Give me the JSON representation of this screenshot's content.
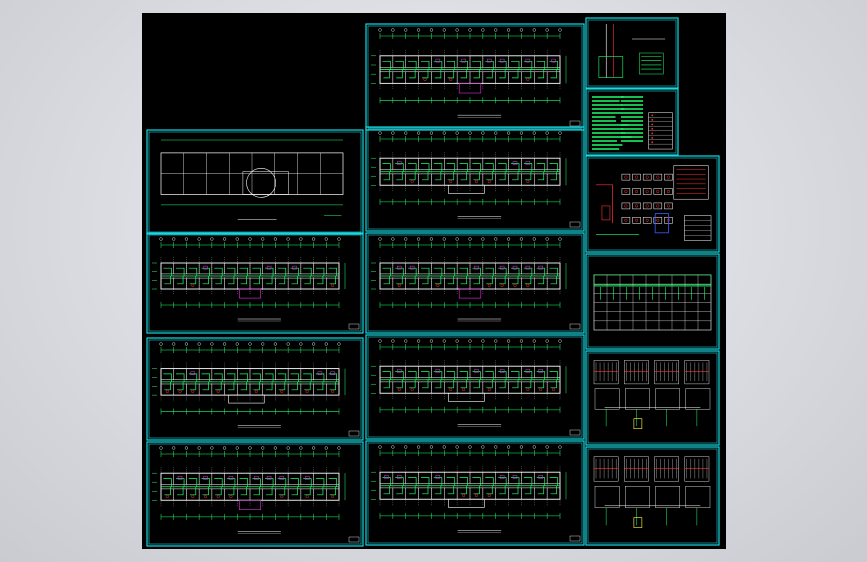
{
  "viewport": {
    "title": ""
  },
  "colors": {
    "background": "#d9dbe0",
    "canvas": "#000000",
    "frame": "#18d8e0",
    "wall": "#ffffff",
    "wiring": "#1cff6a",
    "magenta": "#e030e0",
    "red": "#ff3030",
    "yellow": "#ffff40",
    "blue": "#3060ff"
  },
  "sheets": [
    {
      "id": "floor-plan-top",
      "kind": "floor-plan",
      "label": ""
    },
    {
      "id": "site-plan",
      "kind": "site-plan",
      "label": ""
    },
    {
      "id": "floor-plan-c2",
      "kind": "floor-plan",
      "label": ""
    },
    {
      "id": "floor-plan-c3",
      "kind": "floor-plan",
      "label": ""
    },
    {
      "id": "floor-plan-c4",
      "kind": "floor-plan",
      "label": ""
    },
    {
      "id": "floor-plan-left-1",
      "kind": "floor-plan",
      "label": ""
    },
    {
      "id": "floor-plan-left-2",
      "kind": "floor-plan",
      "label": ""
    },
    {
      "id": "floor-plan-left-3",
      "kind": "floor-plan",
      "label": ""
    },
    {
      "id": "floor-plan-c5",
      "kind": "floor-plan",
      "label": ""
    },
    {
      "id": "detail-sheet",
      "kind": "detail",
      "label": ""
    },
    {
      "id": "notes-sheet",
      "kind": "notes",
      "label": ""
    },
    {
      "id": "system-diagram",
      "kind": "system-diagram",
      "label": ""
    },
    {
      "id": "schedule-table",
      "kind": "table",
      "label": ""
    },
    {
      "id": "panel-diagram-1",
      "kind": "panel-diagram",
      "label": ""
    },
    {
      "id": "panel-diagram-2",
      "kind": "panel-diagram",
      "label": ""
    }
  ]
}
